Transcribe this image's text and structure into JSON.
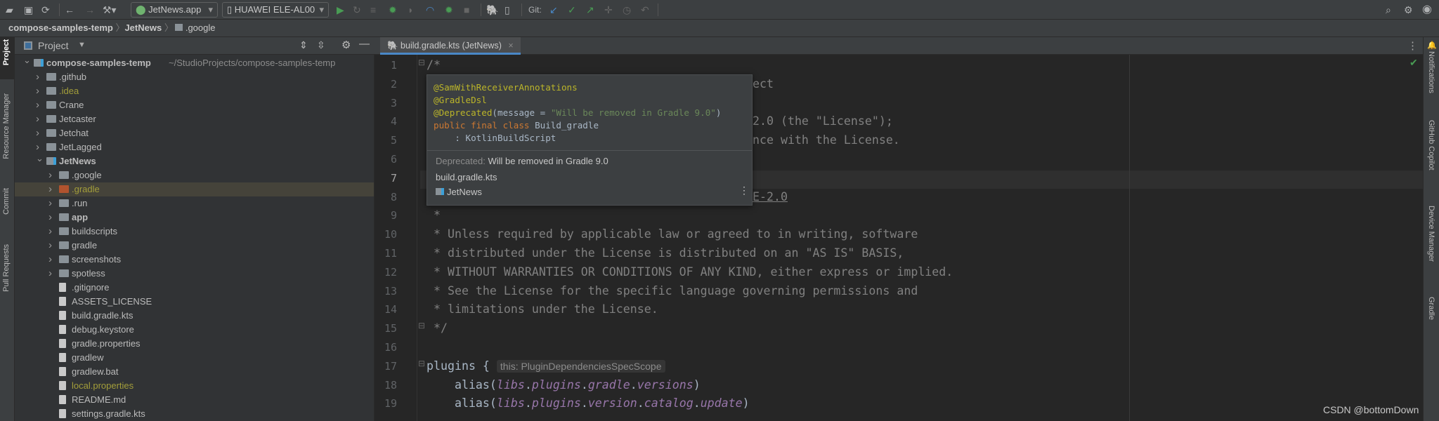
{
  "toolbar": {
    "run_config": "JetNews.app",
    "device": "HUAWEI ELE-AL00",
    "git_label": "Git:",
    "icons": [
      "open-folder-icon",
      "save-icon",
      "sync-icon",
      "back-icon",
      "forward-icon",
      "build-icon",
      "run-icon",
      "rerun-icon",
      "apply-changes-icon",
      "debug-icon",
      "attach-debugger-icon",
      "profile-icon",
      "debug-android-icon",
      "stop-icon",
      "gradle-sync-icon",
      "device-manager-icon",
      "git-update-icon",
      "git-commit-icon",
      "git-push-icon",
      "git-merge-icon",
      "git-history-icon",
      "git-rollback-icon",
      "search-icon",
      "gear-icon",
      "avatar-icon"
    ]
  },
  "breadcrumb": [
    "compose-samples-temp",
    "JetNews",
    ".google"
  ],
  "left_strip": [
    "Project",
    "Resource Manager",
    "Commit",
    "Pull Requests"
  ],
  "right_strip": [
    "Notifications",
    "GitHub Copilot",
    "Device Manager",
    "Gradle"
  ],
  "project_panel": {
    "title": "Project",
    "root_path": "~/StudioProjects/compose-samples-temp",
    "tree": [
      {
        "label": "compose-samples-temp",
        "level": 0,
        "kind": "module",
        "expanded": true,
        "bold": true
      },
      {
        "label": ".github",
        "level": 1,
        "kind": "folder"
      },
      {
        "label": ".idea",
        "level": 1,
        "kind": "folder",
        "color": "#a39e3a"
      },
      {
        "label": "Crane",
        "level": 1,
        "kind": "folder"
      },
      {
        "label": "Jetcaster",
        "level": 1,
        "kind": "folder"
      },
      {
        "label": "Jetchat",
        "level": 1,
        "kind": "folder"
      },
      {
        "label": "JetLagged",
        "level": 1,
        "kind": "folder"
      },
      {
        "label": "JetNews",
        "level": 1,
        "kind": "module",
        "expanded": true,
        "bold": true
      },
      {
        "label": ".google",
        "level": 2,
        "kind": "folder"
      },
      {
        "label": ".gradle",
        "level": 2,
        "kind": "folder",
        "color": "#a39e3a",
        "folder_color": "#b0532e",
        "selected": true
      },
      {
        "label": ".run",
        "level": 2,
        "kind": "folder"
      },
      {
        "label": "app",
        "level": 2,
        "kind": "folder",
        "bold": true
      },
      {
        "label": "buildscripts",
        "level": 2,
        "kind": "folder"
      },
      {
        "label": "gradle",
        "level": 2,
        "kind": "folder"
      },
      {
        "label": "screenshots",
        "level": 2,
        "kind": "folder"
      },
      {
        "label": "spotless",
        "level": 2,
        "kind": "folder"
      },
      {
        "label": ".gitignore",
        "level": 2,
        "kind": "file"
      },
      {
        "label": "ASSETS_LICENSE",
        "level": 2,
        "kind": "file"
      },
      {
        "label": "build.gradle.kts",
        "level": 2,
        "kind": "file"
      },
      {
        "label": "debug.keystore",
        "level": 2,
        "kind": "file"
      },
      {
        "label": "gradle.properties",
        "level": 2,
        "kind": "file"
      },
      {
        "label": "gradlew",
        "level": 2,
        "kind": "file"
      },
      {
        "label": "gradlew.bat",
        "level": 2,
        "kind": "file"
      },
      {
        "label": "local.properties",
        "level": 2,
        "kind": "file",
        "color": "#a39e3a"
      },
      {
        "label": "README.md",
        "level": 2,
        "kind": "file"
      },
      {
        "label": "settings.gradle.kts",
        "level": 2,
        "kind": "file"
      }
    ]
  },
  "editor": {
    "tab": "build.gradle.kts (JetNews)",
    "current_line": 7,
    "lines": [
      {
        "n": 1,
        "tokens": [
          {
            "t": "/*",
            "c": "comment"
          }
        ]
      },
      {
        "n": 2,
        "tail": "ect"
      },
      {
        "n": 3,
        "tokens": []
      },
      {
        "n": 4,
        "tail": "2.0 (the \"License\");"
      },
      {
        "n": 5,
        "tail": "nce with the License."
      },
      {
        "n": 6,
        "tokens": []
      },
      {
        "n": 7,
        "tokens": []
      },
      {
        "n": 8,
        "tail": "E-2.0",
        "underline": true
      },
      {
        "n": 9,
        "tokens": [
          {
            "t": " *",
            "c": "comment"
          }
        ]
      },
      {
        "n": 10,
        "tokens": [
          {
            "t": " * Unless required by applicable law or agreed to in writing, software",
            "c": "comment"
          }
        ]
      },
      {
        "n": 11,
        "tokens": [
          {
            "t": " * distributed under the License is distributed on an \"AS IS\" BASIS,",
            "c": "comment"
          }
        ]
      },
      {
        "n": 12,
        "tokens": [
          {
            "t": " * WITHOUT WARRANTIES OR CONDITIONS OF ANY KIND, either express or implied.",
            "c": "comment"
          }
        ]
      },
      {
        "n": 13,
        "tokens": [
          {
            "t": " * See the License for the specific language governing permissions and",
            "c": "comment"
          }
        ]
      },
      {
        "n": 14,
        "tokens": [
          {
            "t": " * limitations under the License.",
            "c": "comment"
          }
        ]
      },
      {
        "n": 15,
        "tokens": [
          {
            "t": " */",
            "c": "comment"
          }
        ]
      },
      {
        "n": 16,
        "tokens": []
      },
      {
        "n": 17,
        "tokens": [
          {
            "t": "plugins { ",
            "c": "plain"
          },
          {
            "t": "this: PluginDependenciesSpecScope",
            "c": "hint"
          }
        ]
      },
      {
        "n": 18,
        "tokens": [
          {
            "t": "    alias(",
            "c": "plain"
          },
          {
            "t": "libs",
            "c": "prop"
          },
          {
            "t": ".",
            "c": "plain"
          },
          {
            "t": "plugins",
            "c": "prop"
          },
          {
            "t": ".",
            "c": "plain"
          },
          {
            "t": "gradle",
            "c": "prop"
          },
          {
            "t": ".",
            "c": "plain"
          },
          {
            "t": "versions",
            "c": "prop"
          },
          {
            "t": ")",
            "c": "plain"
          }
        ]
      },
      {
        "n": 19,
        "tokens": [
          {
            "t": "    alias(",
            "c": "plain"
          },
          {
            "t": "libs",
            "c": "prop"
          },
          {
            "t": ".",
            "c": "plain"
          },
          {
            "t": "plugins",
            "c": "prop"
          },
          {
            "t": ".",
            "c": "plain"
          },
          {
            "t": "version",
            "c": "prop"
          },
          {
            "t": ".",
            "c": "plain"
          },
          {
            "t": "catalog",
            "c": "prop"
          },
          {
            "t": ".",
            "c": "plain"
          },
          {
            "t": "update",
            "c": "prop"
          },
          {
            "t": ")",
            "c": "plain"
          }
        ]
      }
    ]
  },
  "popup": {
    "signature": [
      [
        {
          "t": "@SamWithReceiverAnnotations",
          "c": "ann"
        }
      ],
      [
        {
          "t": "@GradleDsl",
          "c": "ann"
        }
      ],
      [
        {
          "t": "@Deprecated",
          "c": "ann"
        },
        {
          "t": "(message = ",
          "c": "plain"
        },
        {
          "t": "\"Will be removed in Gradle 9.0\"",
          "c": "str"
        },
        {
          "t": ")",
          "c": "plain"
        }
      ],
      [
        {
          "t": "public final class ",
          "c": "kw"
        },
        {
          "t": "Build_gradle",
          "c": "plain"
        }
      ],
      [
        {
          "t": "    : KotlinBuildScript",
          "c": "plain"
        }
      ]
    ],
    "deprecated_label": "Deprecated:",
    "deprecated_text": "Will be removed in Gradle 9.0",
    "file": "build.gradle.kts",
    "module": "JetNews"
  },
  "watermark": "CSDN @bottomDown",
  "colors": {
    "accent": "#4a88c7",
    "comment": "#808080",
    "keyword": "#cc7832",
    "annotation": "#bbb529",
    "string": "#6a8759",
    "property": "#9876aa"
  }
}
